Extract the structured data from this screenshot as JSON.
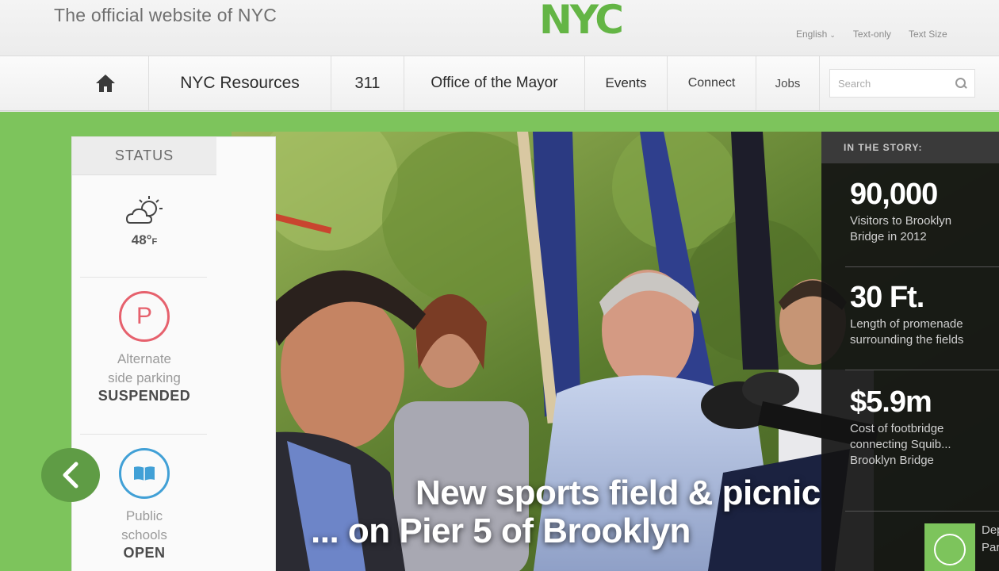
{
  "header": {
    "tagline": "The official website of NYC",
    "logo": "NYC",
    "language": "English",
    "text_only": "Text-only",
    "text_size": "Text Size"
  },
  "nav": {
    "home_icon": "home-icon",
    "items": [
      "NYC Resources",
      "311",
      "Office of the Mayor",
      "Events",
      "Connect",
      "Jobs"
    ],
    "search_placeholder": "Search"
  },
  "status": {
    "title": "STATUS",
    "weather": {
      "icon": "cloud-sun-icon",
      "temp": "48°",
      "unit": "F"
    },
    "parking": {
      "icon_letter": "P",
      "label_line1": "Alternate",
      "label_line2": "side parking",
      "state": "SUSPENDED"
    },
    "schools": {
      "icon": "book-icon",
      "label_line1": "Public",
      "label_line2": "schools",
      "state": "OPEN"
    }
  },
  "hero": {
    "headline_line1": "New sports field & picnic",
    "headline_line2": "... on Pier 5 of Brooklyn"
  },
  "story": {
    "title": "IN THE STORY:",
    "stats": [
      {
        "num": "90,000",
        "line1": "Visitors to Brooklyn",
        "line2": "Bridge in 2012"
      },
      {
        "num": "30 Ft.",
        "line1": "Length of promenade",
        "line2": "surrounding the fields"
      },
      {
        "num": "$5.9m",
        "line1": "Cost of footbridge",
        "line2": "connecting Squib...",
        "line3": "Brooklyn Bridge"
      }
    ],
    "more_line1": "Dep",
    "more_line2": "Park"
  },
  "colors": {
    "brand_green": "#7dc45c",
    "logo_green": "#64b545",
    "parking_red": "#e6616d",
    "school_blue": "#41a0d6"
  }
}
